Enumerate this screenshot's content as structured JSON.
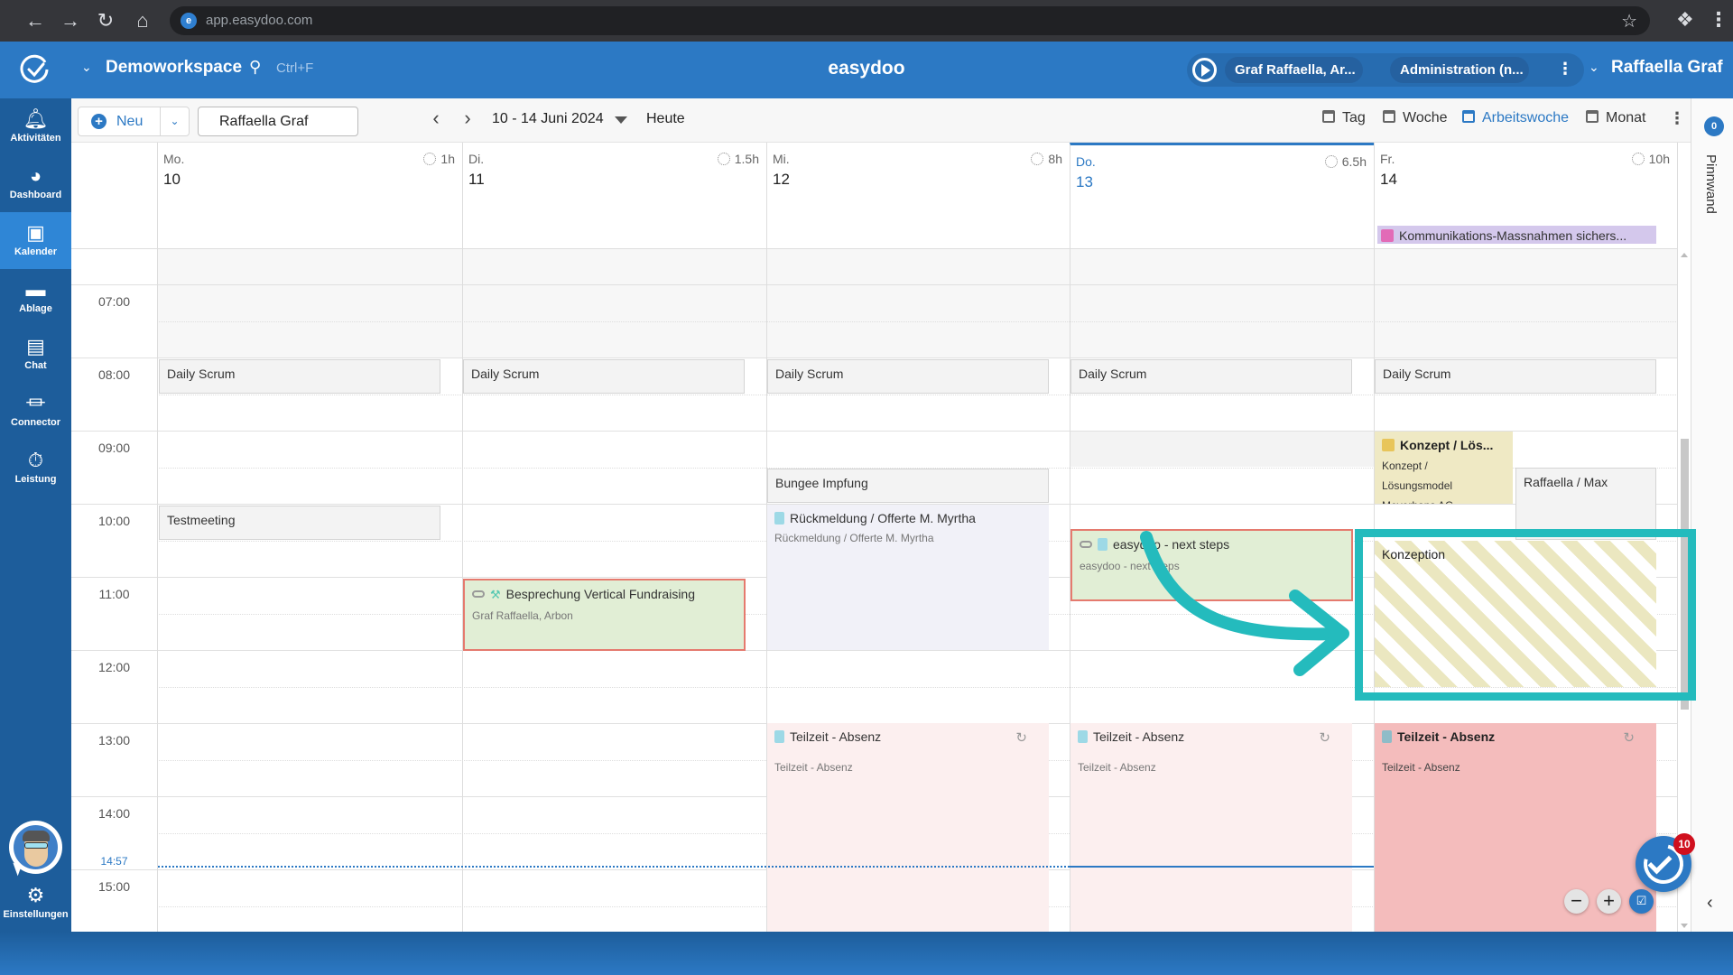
{
  "browser": {
    "url": "app.easydoo.com",
    "nav": [
      "back-icon",
      "forward-icon",
      "reload-icon",
      "home-icon"
    ]
  },
  "header": {
    "workspace": "Demoworkspace",
    "search_hint": "Ctrl+F",
    "app_title": "easydoo",
    "timer_user": "Graf Raffaella, Ar...",
    "timer_project": "Administration (n...",
    "user_name": "Raffaella Graf"
  },
  "sidebar": {
    "items": [
      {
        "label": "Aktivitäten",
        "icon": "bell-icon"
      },
      {
        "label": "Dashboard",
        "icon": "gauge-icon"
      },
      {
        "label": "Kalender",
        "icon": "calendar-icon",
        "active": true
      },
      {
        "label": "Ablage",
        "icon": "folder-icon"
      },
      {
        "label": "Chat",
        "icon": "chat-icon"
      },
      {
        "label": "Connector",
        "icon": "plug-icon"
      },
      {
        "label": "Leistung",
        "icon": "stopwatch-icon"
      }
    ],
    "settings_label": "Einstellungen"
  },
  "toolbar": {
    "new_label": "Neu",
    "person_value": "Raffaella Graf",
    "date_range": "10 - 14 Juni 2024",
    "today_label": "Heute",
    "views": [
      {
        "label": "Tag",
        "active": false
      },
      {
        "label": "Woche",
        "active": false
      },
      {
        "label": "Arbeitswoche",
        "active": true
      },
      {
        "label": "Monat",
        "active": false
      }
    ]
  },
  "pinboard": {
    "count": "0",
    "label": "Pinnwand"
  },
  "calendar": {
    "days": [
      {
        "name": "Mo.",
        "date": "10",
        "hours": "1h"
      },
      {
        "name": "Di.",
        "date": "11",
        "hours": "1.5h"
      },
      {
        "name": "Mi.",
        "date": "12",
        "hours": "8h"
      },
      {
        "name": "Do.",
        "date": "13",
        "hours": "6.5h",
        "today": true
      },
      {
        "name": "Fr.",
        "date": "14",
        "hours": "10h"
      }
    ],
    "time_labels": [
      "07:00",
      "08:00",
      "09:00",
      "10:00",
      "11:00",
      "12:00",
      "13:00",
      "14:00",
      "15:00"
    ],
    "now_label": "14:57",
    "allday_events": [
      {
        "day": 4,
        "title": "Kommunikations-Massnahmen sichers..."
      }
    ],
    "events": {
      "scrum_title": "Daily Scrum",
      "testmeeting": "Testmeeting",
      "bungee": "Bungee Impfung",
      "rueckmeldung_title": "Rückmeldung / Offerte M. Myrtha",
      "rueckmeldung_sub": "Rückmeldung / Offerte M. Myrtha",
      "besprechung_title": "Besprechung Vertical Fundraising",
      "besprechung_sub": "Graf Raffaella, Arbon",
      "nextsteps_title": "easydoo - next steps",
      "nextsteps_sub": "easydoo - next steps",
      "konzept_title": "Konzept / Lös...",
      "konzept_sub": "Konzept / Lösungsmodel Meyerhans AG",
      "raffmax_title": "Raffaella / Max",
      "konzeption_title": "Konzeption",
      "teilzeit_title": "Teilzeit - Absenz",
      "teilzeit_sub": "Teilzeit - Absenz"
    }
  },
  "floating": {
    "task_badge": "10"
  },
  "colors": {
    "brand": "#2c79c4",
    "sidebar": "#1d5d9b",
    "highlight": "#24bbbd",
    "absence_today": "#f4bcbc",
    "event_green": "#e1eed5",
    "event_border_red": "#e57a6e"
  }
}
